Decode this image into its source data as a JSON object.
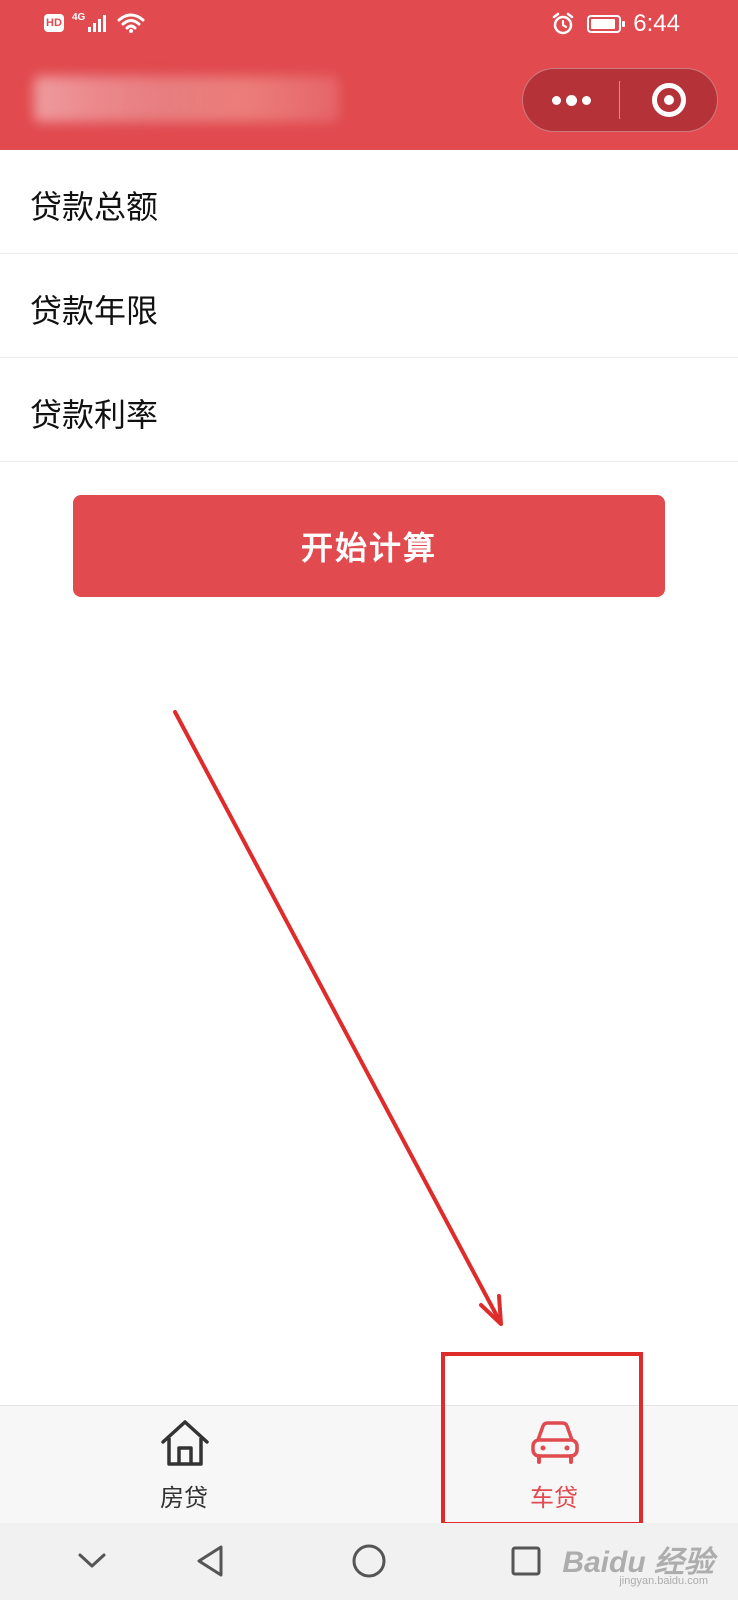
{
  "status_bar": {
    "hd": "HD",
    "network": "4G",
    "time": "6:44"
  },
  "header": {
    "title_blurred": true,
    "menu_icon": "more-dots-icon",
    "close_icon": "target-close-icon"
  },
  "form": {
    "rows": [
      {
        "label": "贷款总额"
      },
      {
        "label": "贷款年限"
      },
      {
        "label": "贷款利率"
      }
    ],
    "submit_label": "开始计算"
  },
  "tabbar": {
    "tabs": [
      {
        "label": "房贷",
        "icon": "house-icon",
        "active": false
      },
      {
        "label": "车贷",
        "icon": "car-icon",
        "active": true
      }
    ]
  },
  "watermark": {
    "brand": "Baidu 经验",
    "url": "jingyan.baidu.com"
  },
  "colors": {
    "brand_red": "#e14a4f",
    "annotation_red": "#e02b2b",
    "tab_inactive": "#333333"
  }
}
